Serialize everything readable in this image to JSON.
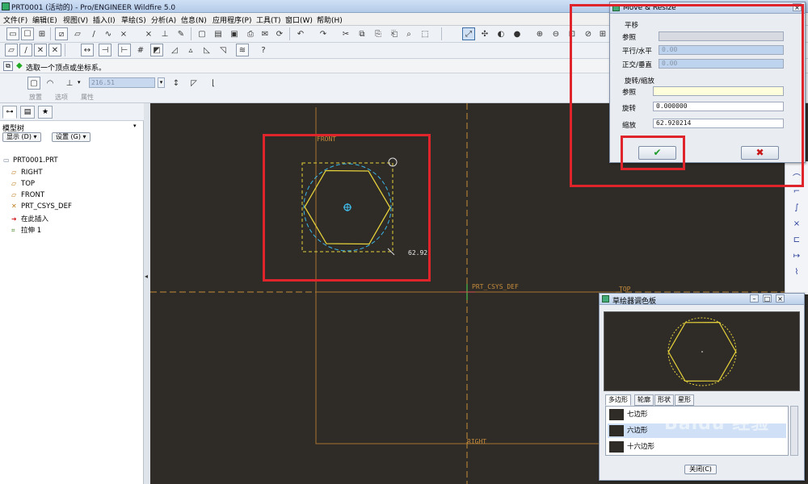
{
  "window": {
    "title": "PRT0001 (活动的) - Pro/ENGINEER Wildfire 5.0"
  },
  "menu": [
    "文件(F)",
    "编辑(E)",
    "视图(V)",
    "插入(I)",
    "草绘(S)",
    "分析(A)",
    "信息(N)",
    "应用程序(P)",
    "工具(T)",
    "窗口(W)",
    "帮助(H)"
  ],
  "status_message": "选取一个顶点或坐标系。",
  "dashboard": {
    "dimension_value": "216.51",
    "tabs": [
      "放置",
      "选项",
      "属性"
    ]
  },
  "model_tree": {
    "tab_label": "模型树",
    "display_button": "显示 (D) ▾",
    "settings_button": "设置 (G) ▾",
    "root": "PRT0001.PRT",
    "items": [
      "RIGHT",
      "TOP",
      "FRONT",
      "PRT_CSYS_DEF",
      "在此插入",
      "拉伸 1"
    ]
  },
  "canvas": {
    "labels": {
      "front": "FRONT",
      "csys": "PRT_CSYS_DEF",
      "top": "TOP",
      "right": "RIGHT",
      "scale_readout": "62.92"
    },
    "colors": {
      "background": "#2f2c28",
      "datum": "#c58b3a",
      "sketch": "#e6d23a",
      "dashed_circle": "#3bb6e6",
      "csys_mark": "#40c0f0"
    }
  },
  "move_resize": {
    "title": "Move & Resize",
    "translate_section": "平移",
    "reference_label": "参照",
    "horizontal_label": "平行/水平",
    "horizontal_value": "0.00",
    "vertical_label": "正交/垂直",
    "vertical_value": "0.00",
    "rotate_section": "旋转/缩放",
    "ref2_label": "参照",
    "rotate_label": "旋转",
    "rotate_value": "0.000000",
    "scale_label": "缩放",
    "scale_value": "62.920214",
    "ok_glyph": "✔",
    "cancel_glyph": "✖"
  },
  "palette": {
    "title": "草绘器调色板",
    "tabs": [
      "多边形",
      "轮廓",
      "形状",
      "星形"
    ],
    "items": [
      "七边形",
      "六边形",
      "十六边形"
    ],
    "selected_index": 1,
    "close_label": "关闭(C)"
  },
  "watermark": {
    "logo": "Baidu 经验",
    "url": "jingyan.baidu.com"
  }
}
